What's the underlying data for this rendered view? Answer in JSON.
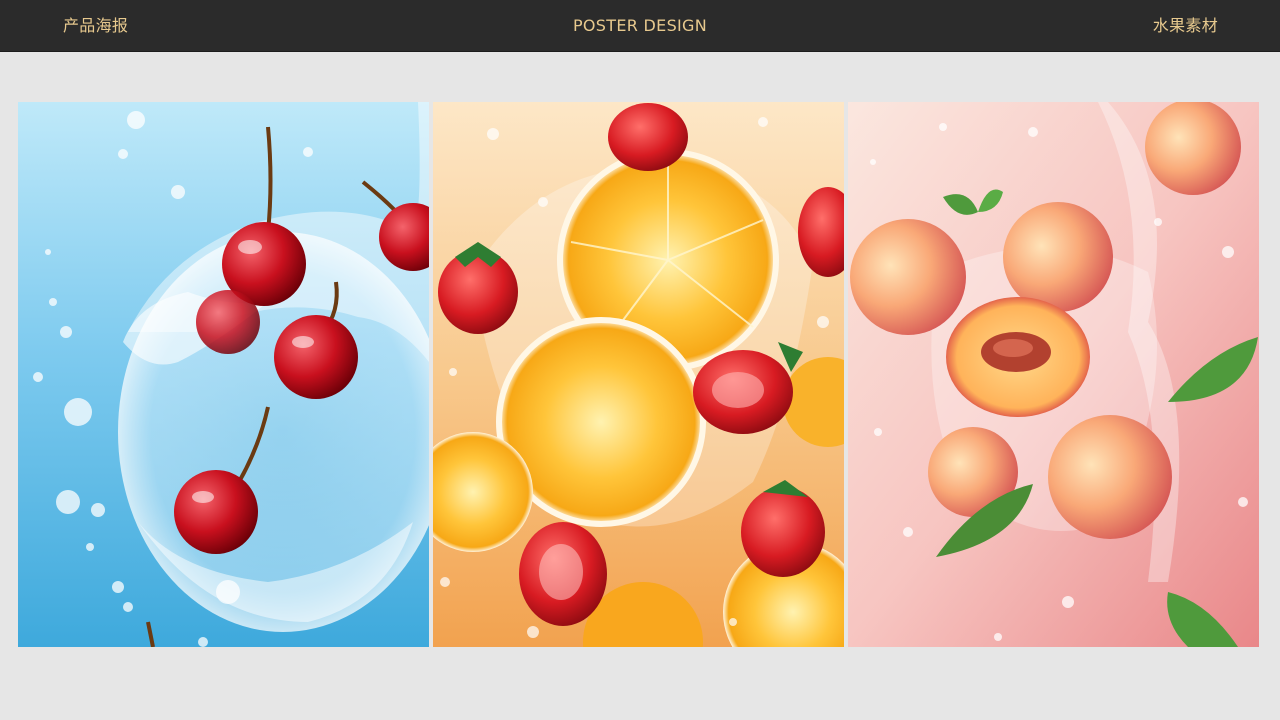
{
  "header": {
    "left_title": "产品海报",
    "center_title": "POSTER DESIGN",
    "right_title": "水果素材"
  },
  "colors": {
    "header_bg": "#2b2b2b",
    "header_text": "#e7c98e",
    "page_bg": "#e6e6e6",
    "cherry_bg": "#5ab8e4",
    "orange_bg": "#f7c98d",
    "peach_bg": "#f4b5b1"
  },
  "posters": [
    {
      "subject": "cherry-water-splash"
    },
    {
      "subject": "orange-strawberry-water-splash"
    },
    {
      "subject": "peach-water-splash"
    }
  ]
}
